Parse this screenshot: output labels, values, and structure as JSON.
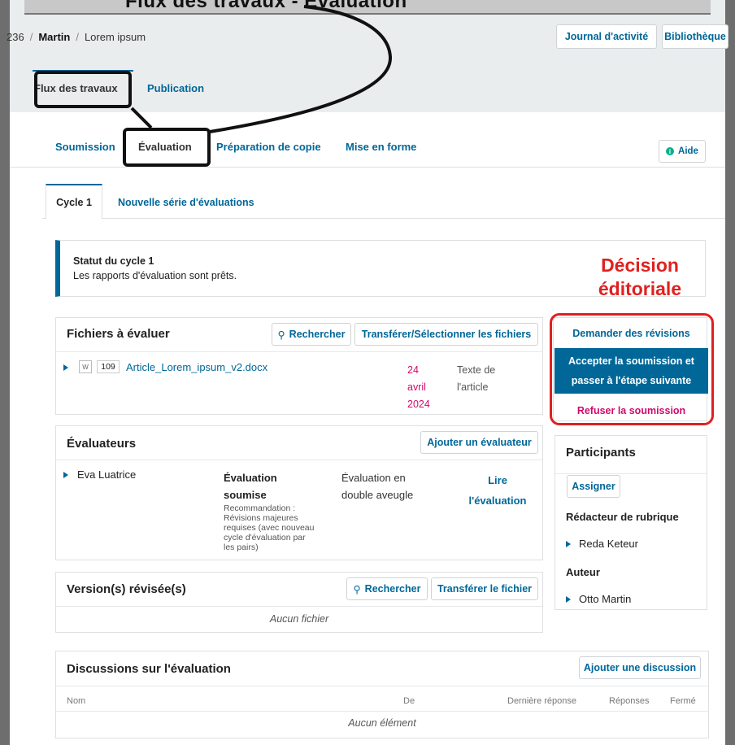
{
  "top_banner": {
    "title": "Flux des travaux - Évaluation"
  },
  "breadcrumb": {
    "id": "236",
    "author": "Martin",
    "title": "Lorem ipsum"
  },
  "header_buttons": {
    "activity_log": "Journal d'activité",
    "library": "Bibliothèque"
  },
  "workflow_tabs": [
    {
      "label": "Flux des travaux",
      "active": true
    },
    {
      "label": "Publication",
      "active": false
    }
  ],
  "stage_tabs": [
    {
      "label": "Soumission"
    },
    {
      "label": "Évaluation"
    },
    {
      "label": "Préparation de copie"
    },
    {
      "label": "Mise en forme"
    }
  ],
  "help_button": {
    "label": "Aide"
  },
  "round_tabs": [
    {
      "label": "Cycle 1"
    },
    {
      "label": "Nouvelle série d'évaluations"
    }
  ],
  "status": {
    "title": "Statut du cycle 1",
    "text": "Les rapports d'évaluation sont prêts."
  },
  "annotation": {
    "line1": "Décision",
    "line2": "éditoriale"
  },
  "review_files": {
    "title": "Fichiers à évaluer",
    "search_label": "Rechercher",
    "upload_label": "Transférer/Sélectionner les fichiers",
    "file": {
      "id": "109",
      "name": "Article_Lorem_ipsum_v2.docx",
      "date_day": "24",
      "date_month": "avril",
      "date_year": "2024",
      "genre_1": "Texte de",
      "genre_2": "l'article"
    }
  },
  "decisions": {
    "request_revisions": "Demander des révisions",
    "accept_1": "Accepter la soumission et",
    "accept_2": "passer à l'étape suivante",
    "decline": "Refuser la soumission"
  },
  "reviewers": {
    "title": "Évaluateurs",
    "add_label": "Ajouter un évaluateur",
    "row": {
      "name": "Eva Luatrice",
      "status_1": "Évaluation",
      "status_2": "soumise",
      "rec_1": "Recommandation :",
      "rec_2": "Révisions majeures",
      "rec_3": "requises (avec nouveau",
      "rec_4": "cycle d'évaluation par",
      "rec_5": "les pairs)",
      "method_1": "Évaluation en",
      "method_2": "double aveugle",
      "read_1": "Lire",
      "read_2": "l'évaluation"
    }
  },
  "participants": {
    "title": "Participants",
    "assign_label": "Assigner",
    "group_1": "Rédacteur de rubrique",
    "person_1": "Reda Keteur",
    "group_2": "Auteur",
    "person_2": "Otto Martin"
  },
  "revisions": {
    "title": "Version(s) révisée(s)",
    "search_label": "Rechercher",
    "upload_label": "Transférer le fichier",
    "empty": "Aucun fichier"
  },
  "discussions": {
    "title": "Discussions sur l'évaluation",
    "add_label": "Ajouter une discussion",
    "columns": [
      "Nom",
      "De",
      "Dernière réponse",
      "Réponses",
      "Fermé"
    ],
    "empty": "Aucun élément"
  },
  "colors": {
    "primary": "#006798",
    "date": "#d00a6c",
    "annotation": "#e02020",
    "decline": "#d00a6c"
  }
}
